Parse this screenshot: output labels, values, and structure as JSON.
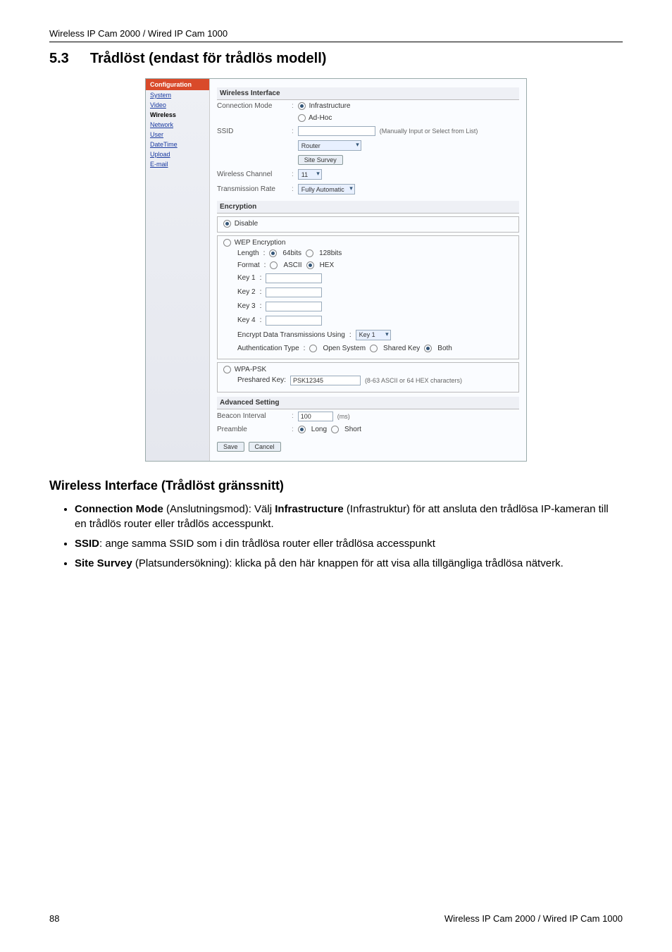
{
  "header": {
    "product": "Wireless IP Cam 2000 / Wired IP Cam 1000"
  },
  "section": {
    "number": "5.3",
    "title": "Trådlöst (endast för trådlös modell)"
  },
  "screenshot": {
    "sidebar": {
      "heading": "Configuration",
      "items": [
        "System",
        "Video",
        "Wireless",
        "Network",
        "User",
        "DateTime",
        "Upload",
        "E-mail"
      ],
      "active": "Wireless"
    },
    "wireless_interface": {
      "heading": "Wireless Interface",
      "conn_mode_label": "Connection Mode",
      "conn_infra": "Infrastructure",
      "conn_adhoc": "Ad-Hoc",
      "ssid_label": "SSID",
      "ssid_hint": "(Manually Input or Select from List)",
      "router_option": "Router",
      "site_survey": "Site Survey",
      "channel_label": "Wireless Channel",
      "channel_value": "11",
      "rate_label": "Transmission Rate",
      "rate_value": "Fully Automatic"
    },
    "encryption": {
      "heading": "Encryption",
      "disable": "Disable",
      "wep": "WEP Encryption",
      "length_label": "Length",
      "len64": "64bits",
      "len128": "128bits",
      "format_label": "Format",
      "fmt_ascii": "ASCII",
      "fmt_hex": "HEX",
      "key1": "Key 1",
      "key2": "Key 2",
      "key3": "Key 3",
      "key4": "Key 4",
      "txkey_label": "Encrypt Data Transmissions Using",
      "txkey_value": "Key 1",
      "authtype_label": "Authentication Type",
      "auth_open": "Open System",
      "auth_shared": "Shared Key",
      "auth_both": "Both",
      "wpapsk": "WPA-PSK",
      "psk_label": "Preshared Key:",
      "psk_value": "PSK12345",
      "psk_hint": "(8-63 ASCII or 64 HEX characters)"
    },
    "advanced": {
      "heading": "Advanced Setting",
      "beacon_label": "Beacon Interval",
      "beacon_value": "100",
      "beacon_unit": "(ms)",
      "preamble_label": "Preamble",
      "preamble_long": "Long",
      "preamble_short": "Short"
    },
    "buttons": {
      "save": "Save",
      "cancel": "Cancel"
    }
  },
  "subsection": {
    "title": "Wireless Interface (Trådlöst gränssnitt)"
  },
  "bullets": {
    "b1_strong1": "Connection Mode",
    "b1_paren1": " (Anslutningsmod): Välj ",
    "b1_strong2": "Infrastructure",
    "b1_rest": " (Infrastruktur) för att ansluta den trådlösa IP-kameran till en trådlös router eller trådlös accesspunkt.",
    "b2_strong": "SSID",
    "b2_rest": ": ange samma SSID som i din trådlösa router eller trådlösa accesspunkt",
    "b3_strong": "Site Survey",
    "b3_rest": " (Platsundersökning): klicka på den här knappen för att visa alla tillgängliga trådlösa nätverk."
  },
  "footer": {
    "page": "88",
    "product": "Wireless IP Cam 2000 / Wired IP Cam 1000"
  }
}
